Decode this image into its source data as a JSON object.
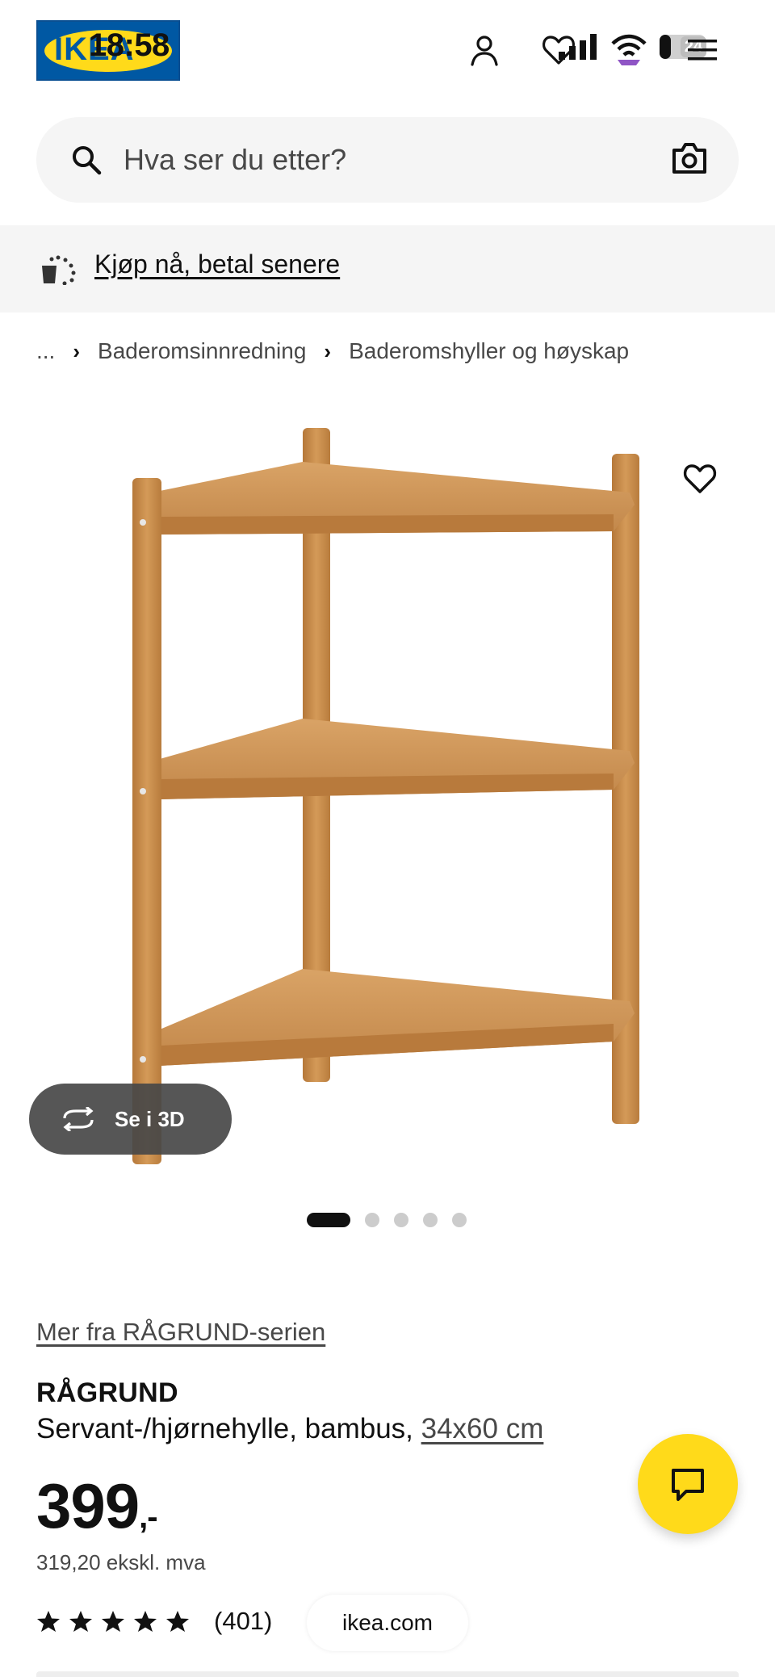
{
  "status_bar": {
    "time": "18:58",
    "battery_level": "24"
  },
  "header": {
    "logo_text": "IKEA",
    "icons": [
      "user-icon",
      "heart-icon",
      "signal-icon",
      "wifi-icon",
      "battery-icon",
      "menu-icon"
    ]
  },
  "search": {
    "placeholder": "Hva ser du etter?"
  },
  "banner": {
    "link": "Kjøp nå, betal senere"
  },
  "breadcrumb": {
    "ellipsis": "...",
    "items": [
      "Baderomsinnredning",
      "Baderomshyller og høyskap"
    ]
  },
  "gallery": {
    "view_3d_label": "Se i 3D",
    "image_count": 5,
    "active_index": 0
  },
  "product": {
    "series_link": "Mer fra RÅGRUND-serien",
    "name": "RÅGRUND",
    "description": "Servant-/hjørnehylle, bambus,",
    "size": "34x60 cm",
    "price_main": "399",
    "price_suffix": ",-",
    "price_ex_vat": "319,20 ekskl. mva",
    "rating_stars": 5,
    "rating_count": "(401)"
  },
  "browser": {
    "url": "ikea.com"
  },
  "colors": {
    "brand_blue": "#0058A3",
    "brand_yellow": "#FFDA1A",
    "bamboo": "#C98F4E"
  }
}
